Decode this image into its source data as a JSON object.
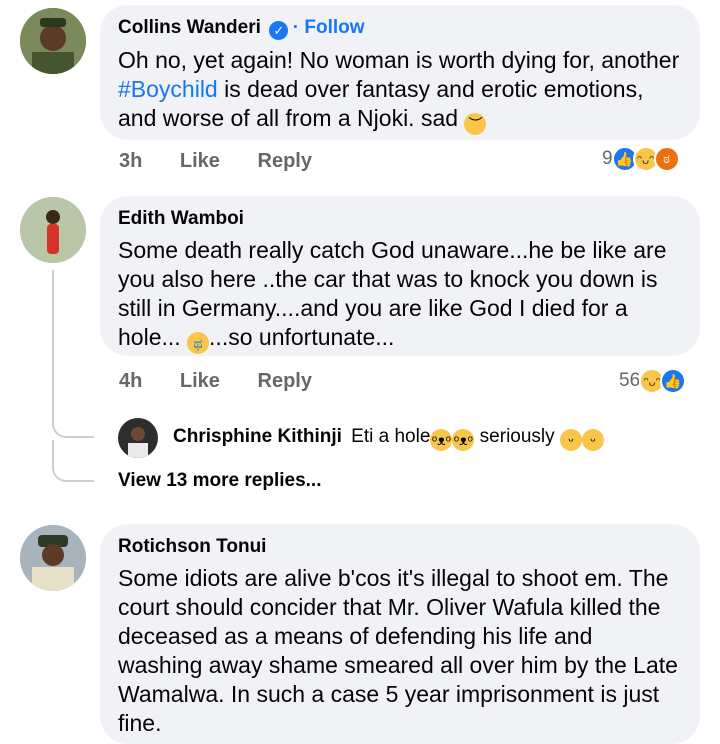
{
  "comments": [
    {
      "author": "Collins Wanderi",
      "follow_label": "· Follow",
      "text_before": "Oh no, yet again! No woman is worth dying for, another ",
      "hashtag": "#Boychild",
      "text_after": " is dead over fantasy and erotic emotions, and worse of all from a Njoki. sad",
      "time": "3h",
      "like_label": "Like",
      "reply_label": "Reply",
      "reaction_count": "9",
      "reactions": [
        "like-icon",
        "haha-icon",
        "angry-icon"
      ]
    },
    {
      "author": "Edith Wamboi",
      "text_before": "Some death really catch God unaware...he be like are you also here ..the car that was to knock you down is still in Germany....and you are like God I died for a hole...",
      "text_after": "...so unfortunate...",
      "time": "4h",
      "like_label": "Like",
      "reply_label": "Reply",
      "reaction_count": "56",
      "reactions": [
        "haha-icon",
        "like-icon"
      ]
    },
    {
      "author": "Rotichson Tonui",
      "text": "Some idiots are alive b'cos it's illegal to shoot em. The court should concider that Mr. Oliver Wafula killed the deceased as a means of defending his life and washing away shame smeared all over him by the Late Wamalwa. In such a case 5 year imprisonment is just fine."
    }
  ],
  "reply": {
    "author": "Chrisphine Kithinji",
    "text_before": "Eti a hole",
    "text_after": " seriously"
  },
  "view_more_label": "View 13 more replies..."
}
